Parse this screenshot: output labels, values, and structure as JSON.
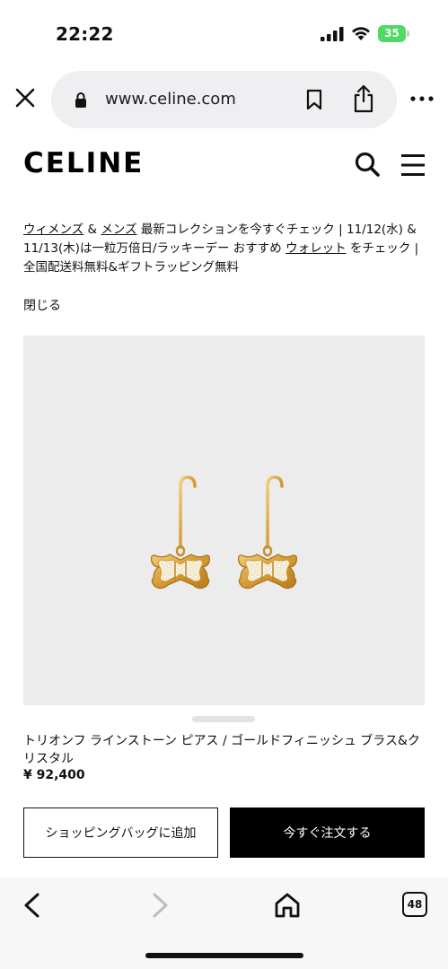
{
  "status": {
    "time": "22:22",
    "battery": "35"
  },
  "browser": {
    "url": "www.celine.com",
    "tab_count": "48"
  },
  "header": {
    "logo": "CELINE"
  },
  "banner": {
    "women": "ウィメンズ",
    "and": " & ",
    "men": "メンズ",
    "text_1": " 最新コレクションを今すぐチェック | 11/12(水) & 11/13(木)は一粒万倍日/ラッキーデー おすすめ ",
    "wallet": "ウォレット",
    "text_2": " をチェック | 全国配送料無料&ギフトラッピング無料",
    "close": "閉じる"
  },
  "product": {
    "name": "トリオンフ ラインストーン ピアス / ゴールドフィニッシュ ブラス&クリスタル",
    "price": "¥ 92,400",
    "add_to_bag": "ショッピングバッグに追加",
    "order_now": "今すぐ注文する"
  },
  "colors": {
    "battery": "#4cd964",
    "image_bg": "#ececec",
    "gold": "#d8a23c"
  }
}
